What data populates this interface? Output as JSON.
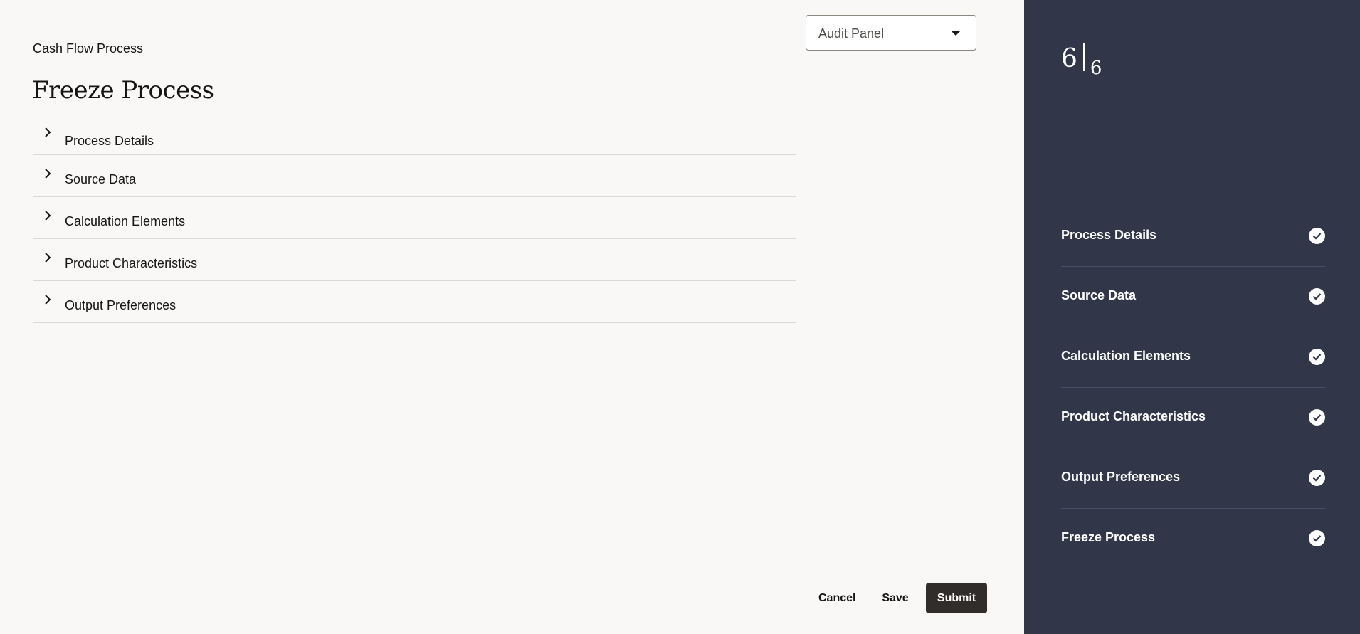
{
  "breadcrumb": "Cash Flow Process",
  "page_title": "Freeze Process",
  "panel_select": {
    "value": "Audit Panel",
    "icon": "caret-down-icon"
  },
  "sections": [
    {
      "label": "Process Details"
    },
    {
      "label": "Source Data"
    },
    {
      "label": "Calculation Elements"
    },
    {
      "label": "Product Characteristics"
    },
    {
      "label": "Output Preferences"
    }
  ],
  "footer": {
    "cancel": "Cancel",
    "save": "Save",
    "submit": "Submit"
  },
  "progress": {
    "current": "6",
    "total": "6"
  },
  "steps": [
    {
      "label": "Process Details",
      "status": "complete"
    },
    {
      "label": "Source Data",
      "status": "complete"
    },
    {
      "label": "Calculation Elements",
      "status": "complete"
    },
    {
      "label": "Product Characteristics",
      "status": "complete"
    },
    {
      "label": "Output Preferences",
      "status": "complete"
    },
    {
      "label": "Freeze Process",
      "status": "complete",
      "current": true
    }
  ],
  "colors": {
    "sidebar": "#313749",
    "primary_button": "#312d2a",
    "background": "#f9f8f6"
  }
}
